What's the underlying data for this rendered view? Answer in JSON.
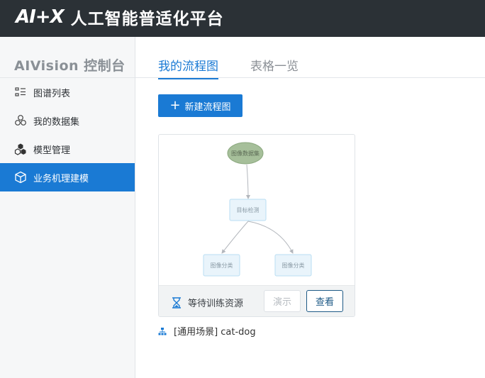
{
  "header": {
    "logo": "AI+X",
    "title": "人工智能普适化平台"
  },
  "sidebar": {
    "console_title": "AIVision 控制台",
    "items": [
      {
        "label": "图谱列表",
        "icon": "list-icon",
        "active": false
      },
      {
        "label": "我的数据集",
        "icon": "dataset-icon",
        "active": false
      },
      {
        "label": "模型管理",
        "icon": "model-cubes-icon",
        "active": false
      },
      {
        "label": "业务机理建模",
        "icon": "cube-icon",
        "active": true
      }
    ]
  },
  "main": {
    "tabs": [
      {
        "label": "我的流程图",
        "active": true
      },
      {
        "label": "表格一览",
        "active": false
      }
    ],
    "new_button": "新建流程图"
  },
  "card": {
    "diagram": {
      "nodes": {
        "source": "图像数据集",
        "detect": "目标检测",
        "classify_a": "图像分类",
        "classify_b": "图像分类"
      }
    },
    "status": "等待训练资源",
    "demo_label": "演示",
    "view_label": "查看",
    "caption": "[通用场景] cat-dog"
  },
  "colors": {
    "accent": "#1a7ad4",
    "topbar": "#2b3136",
    "view_border": "#1e5a86",
    "status_icon": "#1a7ad4"
  }
}
